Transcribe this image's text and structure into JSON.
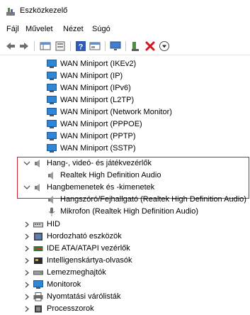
{
  "window": {
    "title": "Eszközkezelő"
  },
  "menu": [
    {
      "label": "Fájl"
    },
    {
      "label": "Művelet"
    },
    {
      "label": "Nézet"
    },
    {
      "label": "Súgó"
    }
  ],
  "toolbar": {
    "buttons": [
      "back-icon",
      "forward-icon",
      "properties-grid-icon",
      "device-properties-icon",
      "help-icon",
      "view-icon",
      "monitor-icon",
      "update-driver-icon",
      "uninstall-icon",
      "download-icon"
    ]
  },
  "wan_items": [
    {
      "label": "WAN Miniport (IKEv2)"
    },
    {
      "label": "WAN Miniport (IP)"
    },
    {
      "label": "WAN Miniport (IPv6)"
    },
    {
      "label": "WAN Miniport (L2TP)"
    },
    {
      "label": "WAN Miniport (Network Monitor)"
    },
    {
      "label": "WAN Miniport (PPPOE)"
    },
    {
      "label": "WAN Miniport (PPTP)"
    },
    {
      "label": "WAN Miniport (SSTP)"
    }
  ],
  "sound_category": {
    "label": "Hang-, videó- és játékvezérlők",
    "state": "expanded"
  },
  "sound_devices": [
    {
      "label": "Realtek High Definition Audio"
    }
  ],
  "audio_io_category": {
    "label": "Hangbemenetek és -kimenetek",
    "state": "expanded"
  },
  "audio_io_devices": [
    {
      "label": "Hangszóró/Fejhallgató (Realtek High Definition Audio)",
      "icon": "speaker-icon"
    },
    {
      "label": "Mikrofon (Realtek High Definition Audio)",
      "icon": "microphone-icon"
    }
  ],
  "categories": [
    {
      "label": "HID",
      "icon": "hid-icon",
      "state": "collapsed"
    },
    {
      "label": "Hordozható eszközök",
      "icon": "portable-device-icon",
      "state": "collapsed"
    },
    {
      "label": "IDE ATA/ATAPI vezérlők",
      "icon": "ide-controller-icon",
      "state": "collapsed"
    },
    {
      "label": "Intelligenskártya-olvasók",
      "icon": "smart-card-reader-icon",
      "state": "collapsed"
    },
    {
      "label": "Lemezmeghajtók",
      "icon": "disk-drive-icon",
      "state": "collapsed"
    },
    {
      "label": "Monitorok",
      "icon": "monitor-icon",
      "state": "collapsed"
    },
    {
      "label": "Nyomtatási várólisták",
      "icon": "print-queue-icon",
      "state": "collapsed"
    },
    {
      "label": "Processzorok",
      "icon": "processor-icon",
      "state": "collapsed"
    }
  ],
  "colors": {
    "highlight_border": "#c8202a",
    "network_icon": "#2f86d6",
    "separator": "#e3e3e3"
  }
}
